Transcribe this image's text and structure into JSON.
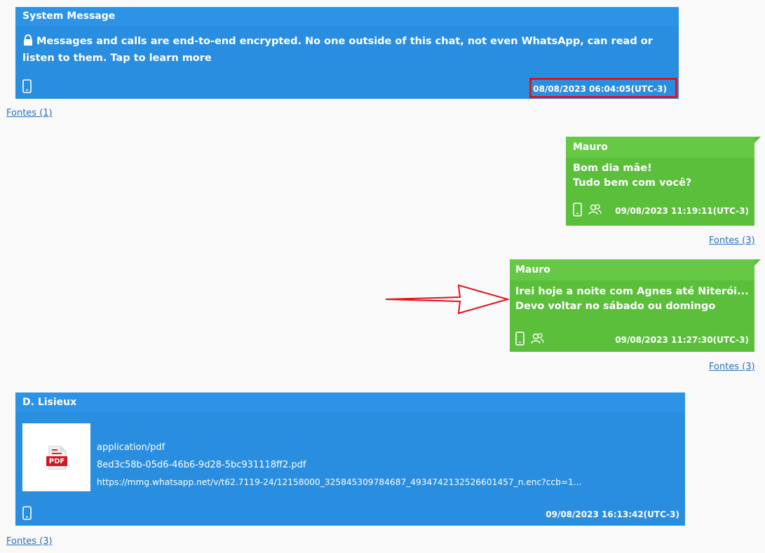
{
  "system_message": {
    "sender": "System Message",
    "text": "Messages and calls are end-to-end encrypted. No one outside of this chat, not even WhatsApp, can read or listen to them. Tap to learn more",
    "timestamp": "08/08/2023 06:04:05(UTC-3)",
    "sources_link": "Fontes (1)"
  },
  "messages": [
    {
      "sender": "Mauro",
      "lines": [
        "Bom dia mãe!",
        "Tudo bem com você?"
      ],
      "timestamp": "09/08/2023 11:19:11(UTC-3)",
      "sources_link": "Fontes (3)"
    },
    {
      "sender": "Mauro",
      "lines": [
        "Irei hoje a noite com Agnes até Niterói...",
        "Devo voltar no sábado ou domingo"
      ],
      "timestamp": "09/08/2023 11:27:30(UTC-3)",
      "sources_link": "Fontes (3)"
    }
  ],
  "attachment_message": {
    "sender": "D. Lisieux",
    "thumbnail_label": "PDF",
    "mime_type": "application/pdf",
    "file_name": "8ed3c58b-05d6-46b6-9d28-5bc931118ff2.pdf",
    "url": "https://mmg.whatsapp.net/v/t62.7119-24/12158000_325845309784687_4934742132526601457_n.enc?ccb=1...",
    "timestamp": "09/08/2023 16:13:42(UTC-3)",
    "sources_link": "Fontes (3)"
  },
  "colors": {
    "incoming_bubble": "#2a8ee0",
    "outgoing_bubble": "#5cbf3c",
    "highlight_box": "#e0121a",
    "annotation_arrow": "#e0121a"
  }
}
